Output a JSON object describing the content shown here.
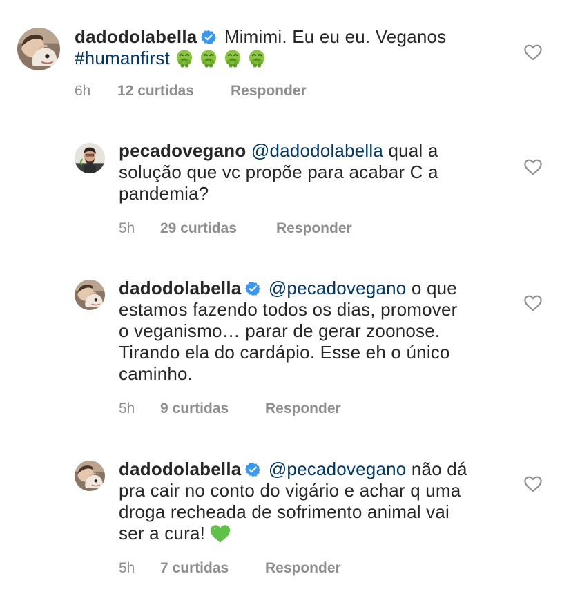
{
  "comments": [
    {
      "username": "dadodolabella",
      "verified": true,
      "text": "Mimimi. Eu eu eu. Veganos",
      "hashtag": "#humanfirst",
      "emoji_icons": [
        "nauseated-face-icon",
        "nauseated-face-icon",
        "nauseated-face-icon",
        "nauseated-face-icon"
      ],
      "time": "6h",
      "likes": "12 curtidas",
      "reply_label": "Responder"
    },
    {
      "username": "pecadovegano",
      "verified": false,
      "mention": "@dadodolabella",
      "line1_rest": "qual a",
      "line2": "solução que vc propõe para acabar C a",
      "line3": "pandemia?",
      "time": "5h",
      "likes": "29 curtidas",
      "reply_label": "Responder"
    },
    {
      "username": "dadodolabella",
      "verified": true,
      "mention": "@pecadovegano",
      "line1_rest": "o que",
      "line2": "estamos fazendo todos os dias, promover",
      "line3": "o veganismo… parar de gerar zoonose.",
      "line4": "Tirando ela do cardápio. Esse eh o único",
      "line5": "caminho.",
      "time": "5h",
      "likes": "9 curtidas",
      "reply_label": "Responder"
    },
    {
      "username": "dadodolabella",
      "verified": true,
      "mention": "@pecadovegano",
      "line1_rest": "não dá",
      "line2": "pra cair no conto do vigário e achar q uma",
      "line3": "droga recheada de sofrimento animal vai",
      "line4": "ser a cura!",
      "emoji_icon": "green-heart-icon",
      "time": "5h",
      "likes": "7 curtidas",
      "reply_label": "Responder"
    }
  ],
  "colors": {
    "text": "#262626",
    "link": "#00376b",
    "meta": "#8e8e8e",
    "verified": "#3897f0",
    "heart_outline": "#8e8e8e",
    "green_heart": "#5fc04a"
  }
}
